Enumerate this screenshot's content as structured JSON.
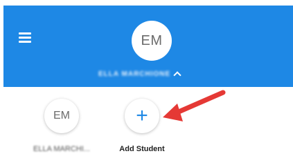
{
  "header": {
    "menu_icon": "hamburger-menu-icon",
    "avatar_initials": "EM",
    "account_name": "ELLA MARCHIONE",
    "expand_icon": "chevron-up-icon",
    "background_color": "#1e88e5"
  },
  "students": [
    {
      "initials": "EM",
      "name": "ELLA MARCHI..."
    }
  ],
  "add_student": {
    "icon": "+",
    "label": "Add Student",
    "icon_color": "#1e88e5"
  },
  "annotation": {
    "arrow_color": "#e53935"
  }
}
